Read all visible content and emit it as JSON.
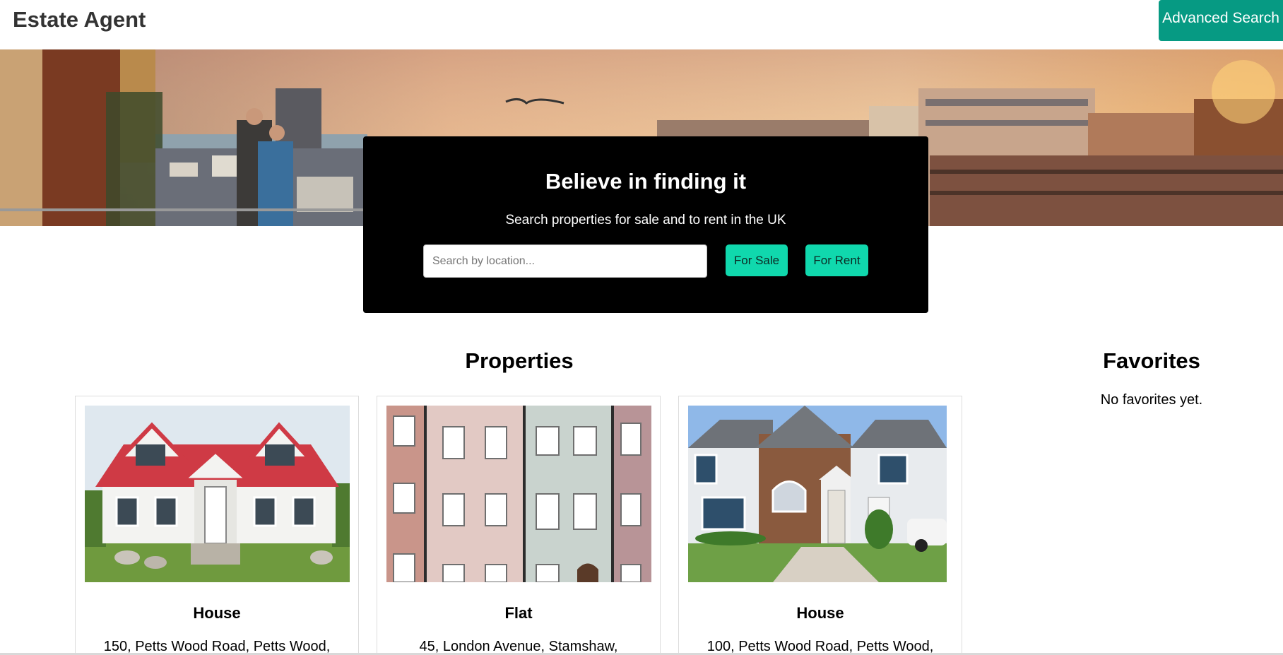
{
  "header": {
    "brand": "Estate Agent",
    "advanced_search_label": "Advanced Search"
  },
  "search": {
    "title": "Believe in finding it",
    "subtitle": "Search properties for sale and to rent in the UK",
    "placeholder": "Search by location...",
    "for_sale_label": "For Sale",
    "for_rent_label": "For Rent"
  },
  "properties": {
    "title": "Properties",
    "items": [
      {
        "type": "House",
        "address": "150, Petts Wood Road, Petts Wood,"
      },
      {
        "type": "Flat",
        "address": "45, London Avenue, Stamshaw,"
      },
      {
        "type": "House",
        "address": "100, Petts Wood Road, Petts Wood,"
      }
    ]
  },
  "favorites": {
    "title": "Favorites",
    "empty_text": "No favorites yet."
  },
  "colors": {
    "accent_dark": "#069a83",
    "accent_bright": "#10d8ad",
    "panel": "#000000"
  }
}
